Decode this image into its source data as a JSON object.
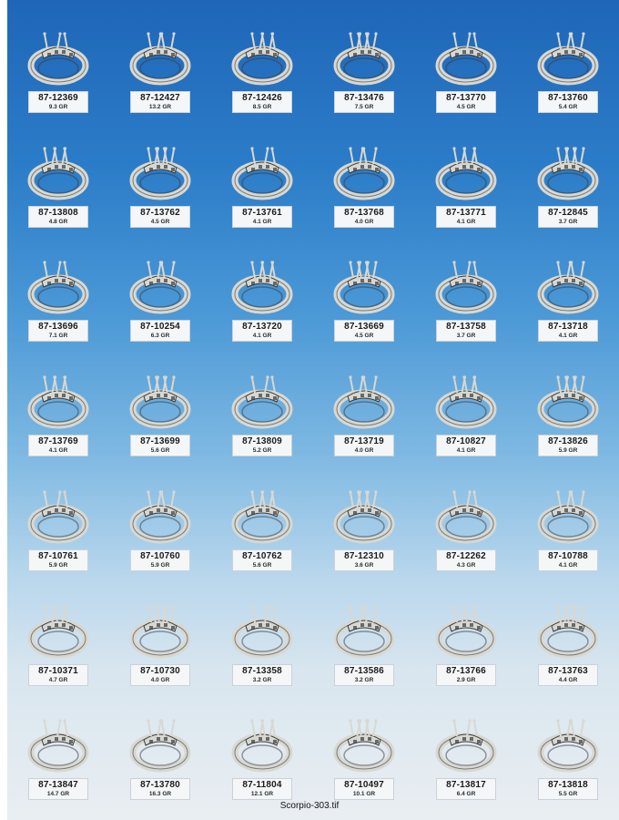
{
  "rows": [
    [
      {
        "code": "87-12369",
        "weight": "9.3 GR"
      },
      {
        "code": "87-12427",
        "weight": "13.2 GR"
      },
      {
        "code": "87-12426",
        "weight": "8.5 GR"
      },
      {
        "code": "87-13476",
        "weight": "7.5 GR"
      },
      {
        "code": "87-13770",
        "weight": "4.5 GR"
      },
      {
        "code": "87-13760",
        "weight": "5.4 GR"
      }
    ],
    [
      {
        "code": "87-13808",
        "weight": "4.8 GR"
      },
      {
        "code": "87-13762",
        "weight": "4.5 GR"
      },
      {
        "code": "87-13761",
        "weight": "4.1 GR"
      },
      {
        "code": "87-13768",
        "weight": "4.0 GR"
      },
      {
        "code": "87-13771",
        "weight": "4.1 GR"
      },
      {
        "code": "87-12845",
        "weight": "3.7 GR"
      }
    ],
    [
      {
        "code": "87-13696",
        "weight": "7.1 GR"
      },
      {
        "code": "87-10254",
        "weight": "6.3 GR"
      },
      {
        "code": "87-13720",
        "weight": "4.1 GR"
      },
      {
        "code": "87-13669",
        "weight": "4.5 GR"
      },
      {
        "code": "87-13758",
        "weight": "3.7 GR"
      },
      {
        "code": "87-13718",
        "weight": "4.1 GR"
      }
    ],
    [
      {
        "code": "87-13769",
        "weight": "4.1 GR"
      },
      {
        "code": "87-13699",
        "weight": "5.6 GR"
      },
      {
        "code": "87-13809",
        "weight": "5.2 GR"
      },
      {
        "code": "87-13719",
        "weight": "4.0 GR"
      },
      {
        "code": "87-10827",
        "weight": "4.1 GR"
      },
      {
        "code": "87-13826",
        "weight": "5.9 GR"
      }
    ],
    [
      {
        "code": "87-10761",
        "weight": "5.9 GR"
      },
      {
        "code": "87-10760",
        "weight": "5.9 GR"
      },
      {
        "code": "87-10762",
        "weight": "5.6 GR"
      },
      {
        "code": "87-12310",
        "weight": "3.6 GR"
      },
      {
        "code": "87-12262",
        "weight": "4.3 GR"
      },
      {
        "code": "87-10788",
        "weight": "4.1 GR"
      }
    ],
    [
      {
        "code": "87-10371",
        "weight": "4.7 GR"
      },
      {
        "code": "87-10730",
        "weight": "4.0 GR"
      },
      {
        "code": "87-13358",
        "weight": "3.2 GR"
      },
      {
        "code": "87-13586",
        "weight": "3.2 GR"
      },
      {
        "code": "87-13766",
        "weight": "2.9 GR"
      },
      {
        "code": "87-13763",
        "weight": "4.4 GR"
      }
    ],
    [
      {
        "code": "87-13847",
        "weight": "14.7 GR"
      },
      {
        "code": "87-13780",
        "weight": "16.3 GR"
      },
      {
        "code": "87-11804",
        "weight": "12.1 GR"
      },
      {
        "code": "87-10497",
        "weight": "10.1 GR"
      },
      {
        "code": "87-13817",
        "weight": "6.4 GR"
      },
      {
        "code": "87-13818",
        "weight": "5.5 GR"
      }
    ]
  ],
  "footer": {
    "filename": "Scorpio-303.tif"
  },
  "colors": {
    "metal": "#d8d8d2",
    "metal_shadow": "#3a3a3a",
    "background_top": "#1f66b8",
    "background_bottom": "#e9eef2"
  }
}
